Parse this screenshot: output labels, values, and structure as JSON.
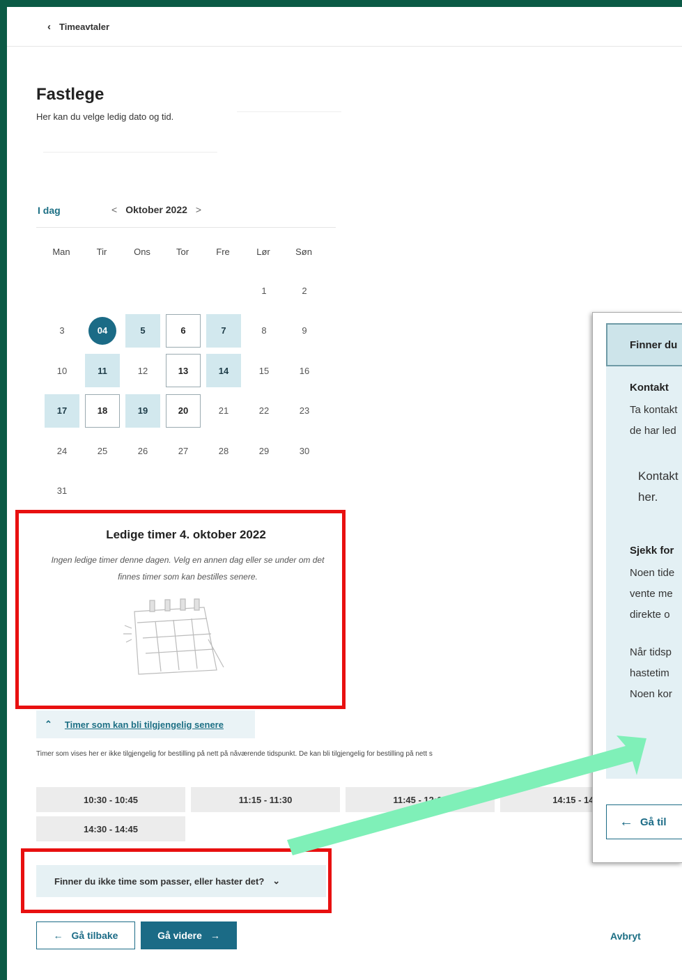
{
  "header": {
    "back_label": "Timeavtaler"
  },
  "page": {
    "title": "Fastlege",
    "subtitle": "Her kan du velge ledig dato og tid."
  },
  "calendar": {
    "today_label": "I dag",
    "month_label": "Oktober 2022",
    "weekdays": [
      "Man",
      "Tir",
      "Ons",
      "Tor",
      "Fre",
      "Lør",
      "Søn"
    ],
    "rows": [
      [
        null,
        null,
        null,
        null,
        null,
        {
          "d": "1"
        },
        {
          "d": "2"
        }
      ],
      [
        {
          "d": "3"
        },
        {
          "d": "04",
          "s": "selected"
        },
        {
          "d": "5",
          "s": "available"
        },
        {
          "d": "6",
          "s": "later"
        },
        {
          "d": "7",
          "s": "available"
        },
        {
          "d": "8"
        },
        {
          "d": "9"
        }
      ],
      [
        {
          "d": "10"
        },
        {
          "d": "11",
          "s": "available"
        },
        {
          "d": "12"
        },
        {
          "d": "13",
          "s": "later"
        },
        {
          "d": "14",
          "s": "available"
        },
        {
          "d": "15"
        },
        {
          "d": "16"
        }
      ],
      [
        {
          "d": "17",
          "s": "available"
        },
        {
          "d": "18",
          "s": "later"
        },
        {
          "d": "19",
          "s": "available"
        },
        {
          "d": "20",
          "s": "later"
        },
        {
          "d": "21"
        },
        {
          "d": "22"
        },
        {
          "d": "23"
        }
      ],
      [
        {
          "d": "24"
        },
        {
          "d": "25"
        },
        {
          "d": "26"
        },
        {
          "d": "27"
        },
        {
          "d": "28"
        },
        {
          "d": "29"
        },
        {
          "d": "30"
        }
      ],
      [
        {
          "d": "31"
        },
        null,
        null,
        null,
        null,
        null,
        null
      ]
    ]
  },
  "no_slots": {
    "title": "Ledige timer 4. oktober 2022",
    "text": "Ingen ledige timer denne dagen. Velg en annen dag eller se under om det finnes timer som kan bestilles senere."
  },
  "later": {
    "toggle_label": "Timer som kan bli tilgjengelig senere",
    "note": "Timer som vises her er ikke tilgjengelig for bestilling på nett på nåværende tidspunkt. De kan bli tilgjengelig for bestilling på nett s",
    "slots": [
      "10:30 - 10:45",
      "11:15 - 11:30",
      "11:45 - 12:00",
      "14:15 - 14:",
      "14:30 - 14:45"
    ]
  },
  "accordion": {
    "label": "Finner du ikke time som passer, eller haster det?"
  },
  "actions": {
    "back": "Gå tilbake",
    "next": "Gå videre",
    "cancel": "Avbryt"
  },
  "panel": {
    "header": "Finner du",
    "contact_heading": "Kontakt",
    "contact_line1": "Ta kontakt",
    "contact_line2": "de har led",
    "contact_box1": "Kontakt",
    "contact_box2": "her.",
    "check_heading": "Sjekk for",
    "check_line1": "Noen tide",
    "check_line2": "vente me",
    "check_line3": "direkte o",
    "check_line4": "Når tidsp",
    "check_line5": "hastetim",
    "check_line6": "Noen kor",
    "back": "Gå til"
  },
  "colors": {
    "frame": "#0b5a45",
    "primary": "#1b6b86",
    "available": "#d2e8ee",
    "highlight": "#e81010",
    "arrow": "#7ff0b8"
  }
}
